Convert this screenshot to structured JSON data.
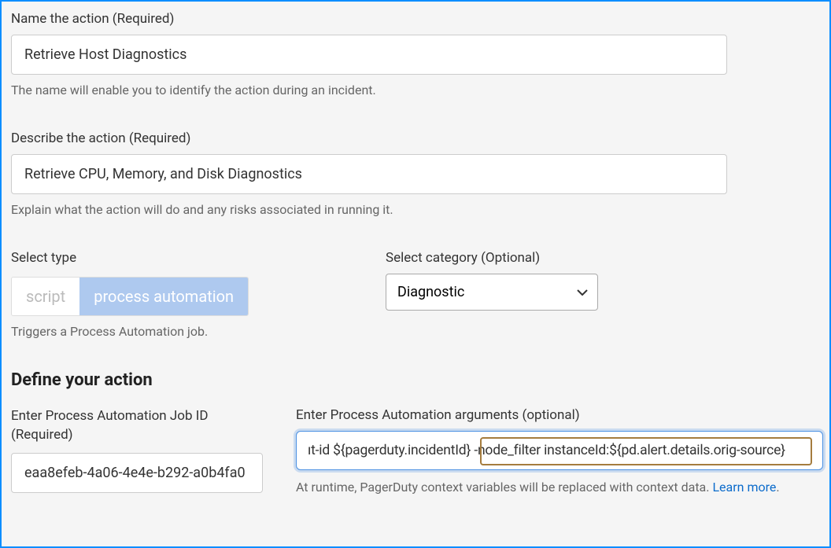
{
  "name_field": {
    "label": "Name the action (Required)",
    "value": "Retrieve Host Diagnostics",
    "helper": "The name will enable you to identify the action during an incident."
  },
  "describe_field": {
    "label": "Describe the action (Required)",
    "value": "Retrieve CPU, Memory, and Disk Diagnostics",
    "helper": "Explain what the action will do and any risks associated in running it."
  },
  "type_field": {
    "label": "Select type",
    "option_script": "script",
    "option_process": "process automation",
    "helper": "Triggers a Process Automation job."
  },
  "category_field": {
    "label": "Select category (Optional)",
    "value": "Diagnostic"
  },
  "define_section": {
    "heading": "Define your action",
    "job_id_label": "Enter Process Automation Job ID (Required)",
    "job_id_value": "eaa8efeb-4a06-4e4e-b292-a0b4fa0",
    "args_label": "Enter Process Automation arguments (optional)",
    "args_value": "ıt-id ${pagerduty.incidentId} -node_filter instanceId:${pd.alert.details.orig-source}",
    "args_helper_prefix": "At runtime, PagerDuty context variables will be replaced with context data. ",
    "learn_more": "Learn more",
    "period": "."
  }
}
